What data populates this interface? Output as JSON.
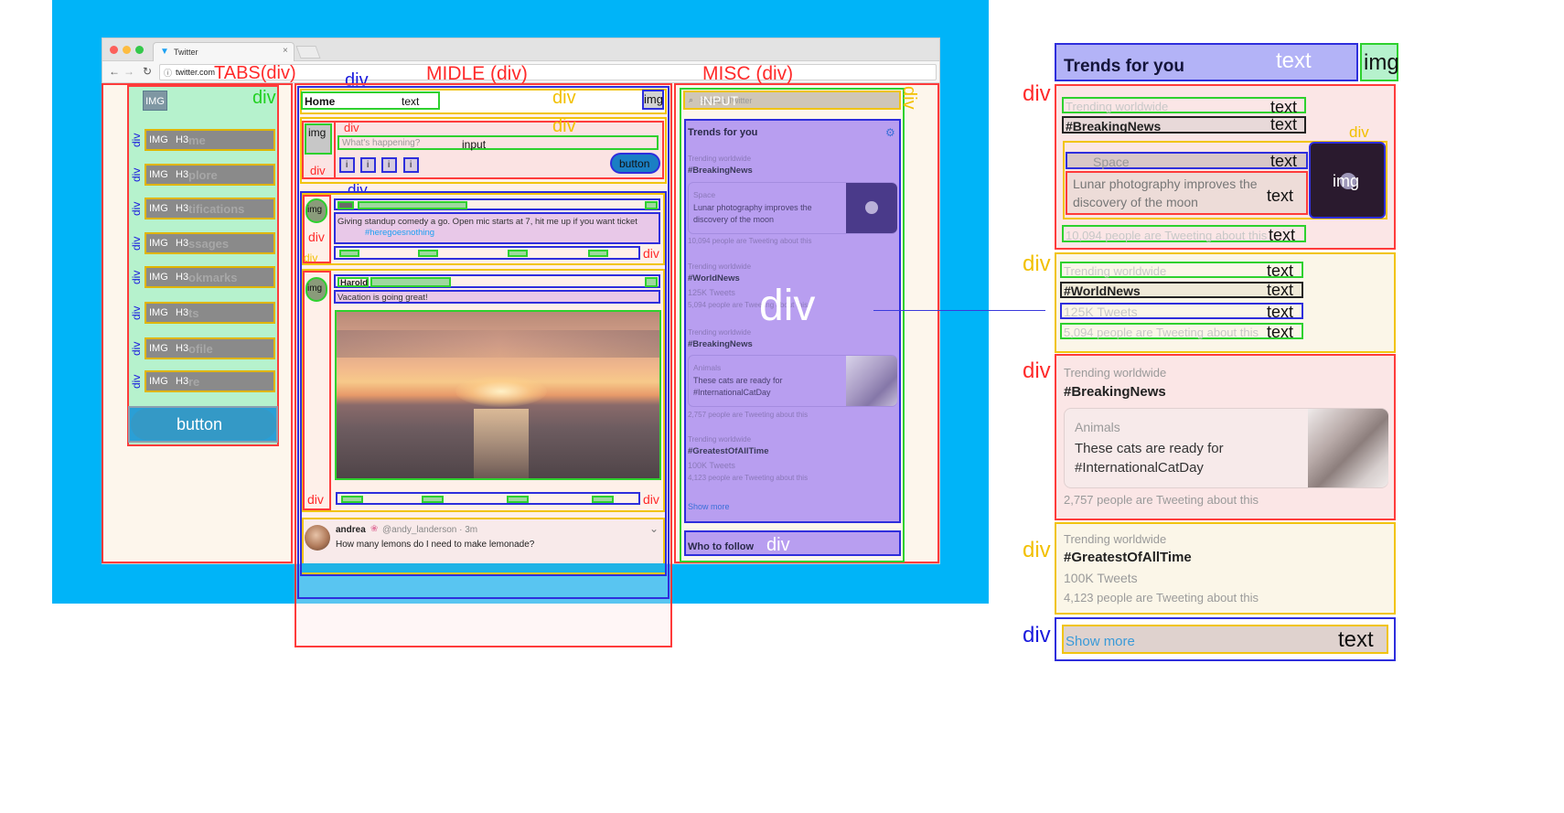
{
  "browser": {
    "tab_title": "Twitter",
    "address": "twitter.com"
  },
  "section_labels": {
    "tabs": "TABS(div)",
    "middle": "MIDLE (div)",
    "misc": "MISC (div)"
  },
  "tags": {
    "div": "div",
    "img": "img",
    "IMG": "IMG",
    "h3": "H3",
    "text": "text",
    "input": "input",
    "button": "button",
    "INPUT": "INPUT"
  },
  "sidebar": {
    "items": [
      "Home",
      "Explore",
      "Notifications",
      "Messages",
      "Bookmarks",
      "Lists",
      "Profile",
      "More"
    ],
    "visible_suffix": [
      "me",
      "plore",
      "tifications",
      "ssages",
      "okmarks",
      "ts",
      "ofile",
      "re"
    ]
  },
  "middle": {
    "header_title": "Home",
    "compose_placeholder": "What's happening?",
    "tweet1": {
      "text": "Giving standup comedy a go. Open mic starts at 7, hit me up if you want ticket",
      "hashtag": "#heregoesnothing"
    },
    "tweet2": {
      "author": "Harold",
      "text": "Vacation is going great!"
    },
    "tweet3": {
      "author": "andrea",
      "handle": "@andy_landerson · 3m",
      "text": "How many lemons do I need to make lemonade?"
    }
  },
  "misc": {
    "search_placeholder": "Search Twitter",
    "trends_title": "Trends for you",
    "trends": [
      {
        "label": "Trending worldwide",
        "tag": "#BreakingNews",
        "card_cat": "Space",
        "card_text": "Lunar photography improves the discovery of the moon",
        "count": "10,094 people are Tweeting about this"
      },
      {
        "label": "Trending worldwide",
        "tag": "#WorldNews",
        "tweets": "125K Tweets",
        "count": "5,094 people are Tweeting about this"
      },
      {
        "label": "Trending worldwide",
        "tag": "#BreakingNews",
        "card_cat": "Animals",
        "card_text": "These cats are ready for #InternationalCatDay",
        "count": "2,757 people are Tweeting about this"
      },
      {
        "label": "Trending worldwide",
        "tag": "#GreatestOfAllTime",
        "tweets": "100K Tweets",
        "count": "4,123 people are Tweeting about this"
      }
    ],
    "show_more": "Show more",
    "who_to_follow": "Who to follow"
  },
  "colors": {
    "canvas_blue": "#00b4f8",
    "tabs_green": "#b6f2cd",
    "misc_purple": "#b89ef0",
    "trends_header_purple": "#b3b3f7",
    "accent_blue": "#1da1f2"
  }
}
